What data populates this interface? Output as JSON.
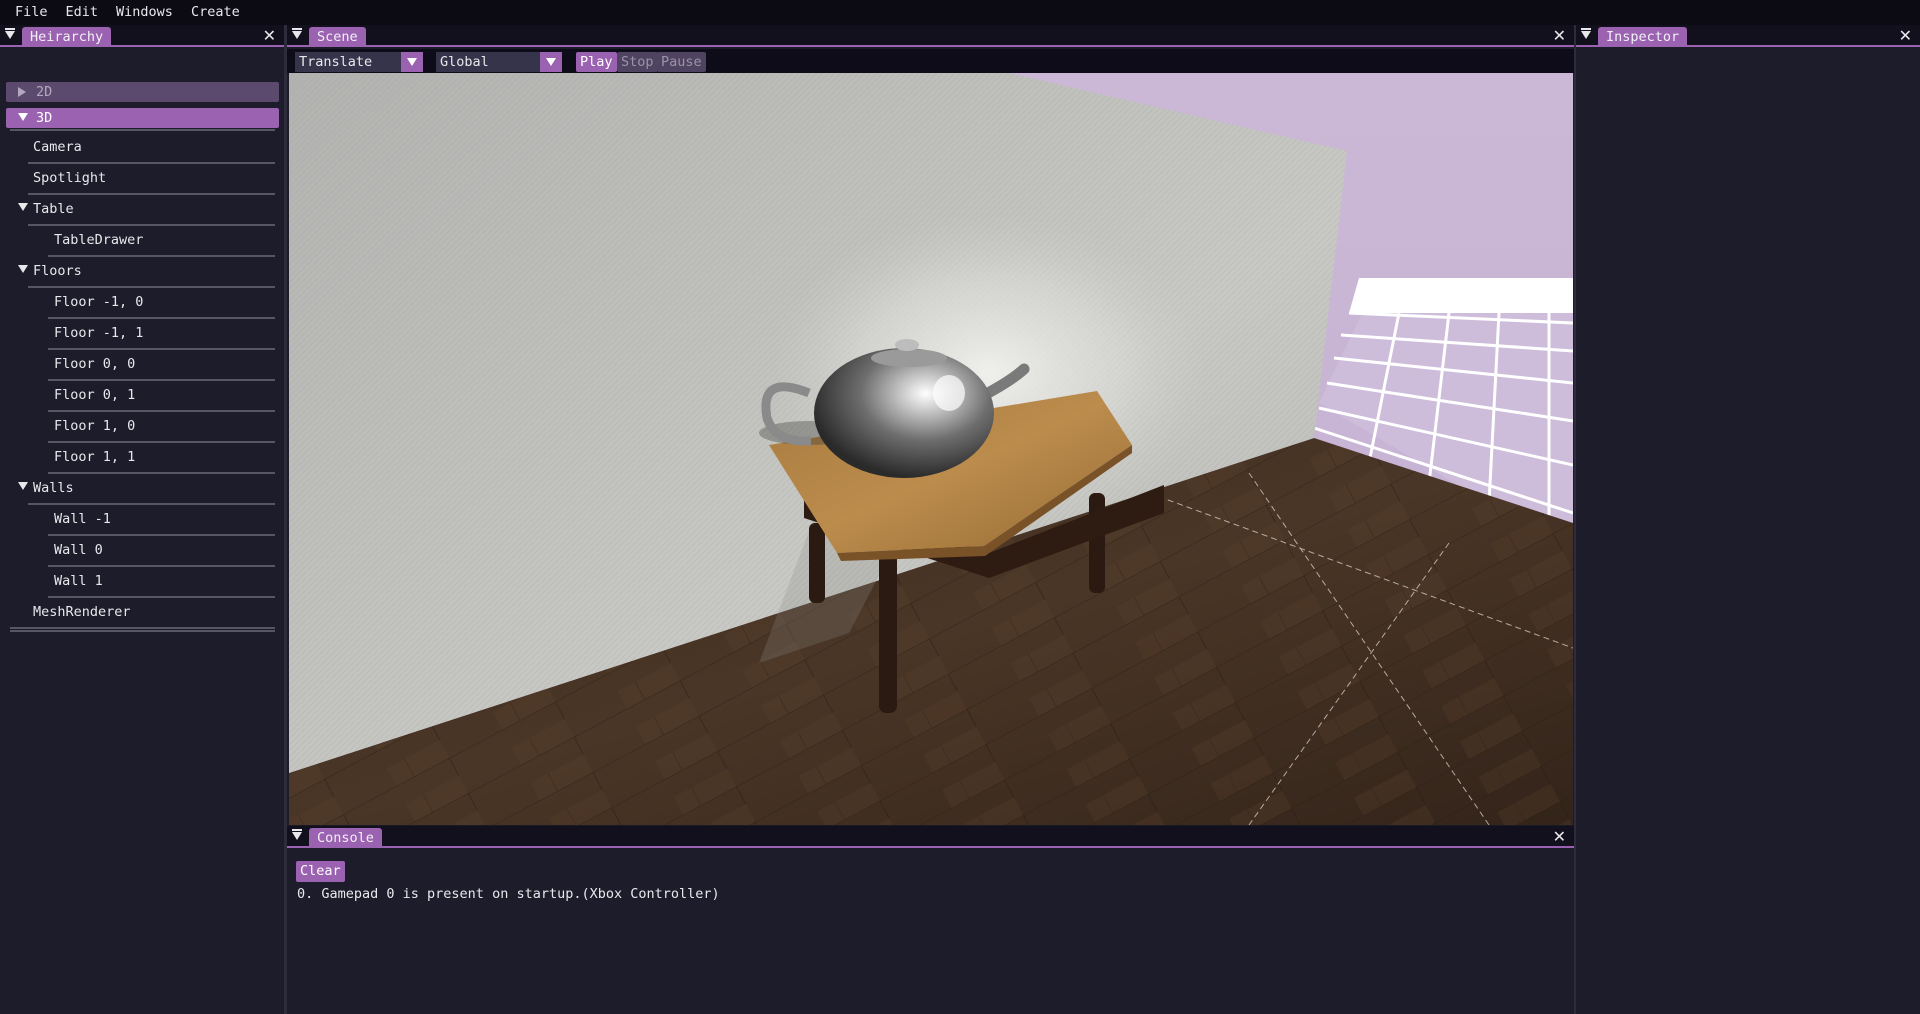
{
  "menubar": {
    "items": [
      "File",
      "Edit",
      "Windows",
      "Create"
    ]
  },
  "hierarchy": {
    "tab": "Heirarchy",
    "groups": {
      "g2d": "2D",
      "g3d": "3D"
    },
    "items": {
      "camera": "Camera",
      "spotlight": "Spotlight",
      "table": "Table",
      "table_drawer": "TableDrawer",
      "floors": "Floors",
      "floor_m1_0": "Floor -1, 0",
      "floor_m1_1": "Floor -1, 1",
      "floor_0_0": "Floor 0, 0",
      "floor_0_1": "Floor 0, 1",
      "floor_1_0": "Floor 1, 0",
      "floor_1_1": "Floor 1, 1",
      "walls": "Walls",
      "wall_m1": "Wall -1",
      "wall_0": "Wall 0",
      "wall_1": "Wall 1",
      "mesh_renderer": "MeshRenderer"
    }
  },
  "scene": {
    "tab": "Scene",
    "transform_mode": "Translate",
    "space_mode": "Global",
    "play_label": "Play",
    "stop_label": "Stop",
    "pause_label": "Pause"
  },
  "inspector": {
    "tab": "Inspector"
  },
  "console": {
    "tab": "Console",
    "clear_label": "Clear",
    "lines": [
      "0. Gamepad 0 is present on startup.(Xbox Controller)"
    ]
  },
  "icons": {
    "close": "close-icon",
    "collapse": "collapse-triangle-icon",
    "dropdown": "chevron-down-icon",
    "expand": "triangle-right-icon"
  },
  "colors": {
    "accent": "#9a62b0",
    "panel_bg": "#1c1c2a",
    "menubar_bg": "#0c0a12",
    "sky": "#cdb9d8"
  }
}
